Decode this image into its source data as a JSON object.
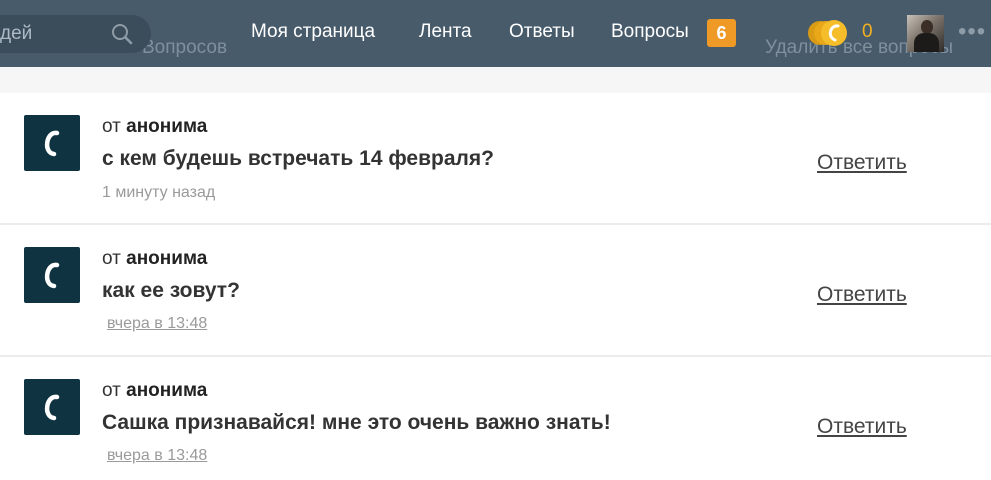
{
  "header": {
    "search_placeholder": "дей",
    "nav": {
      "my_page": "Моя страница",
      "feed": "Лента",
      "answers": "Ответы",
      "questions": "Вопросы"
    },
    "questions_badge": "6",
    "coins_count": "0",
    "more": "•••"
  },
  "background_text": {
    "left": "Вопросов",
    "right": "Удалить все вопросы"
  },
  "questions": [
    {
      "from_prefix": "от",
      "from_name": "анонима",
      "text": "с кем будешь встречать 14 февраля?",
      "time": "1 минуту назад",
      "answer_label": "Ответить"
    },
    {
      "from_prefix": "от",
      "from_name": "анонима",
      "text": "как ее зовут?",
      "time": "вчера в 13:48",
      "answer_label": "Ответить"
    },
    {
      "from_prefix": "от",
      "from_name": "анонима",
      "text": "Сашка признавайся! мне это очень важно знать!",
      "time": "вчера в 13:48",
      "answer_label": "Ответить"
    }
  ],
  "colors": {
    "header_bg": "#485b6b",
    "badge": "#ef9a27",
    "coin": "#f2b020",
    "logo_bg": "#0f3340"
  }
}
